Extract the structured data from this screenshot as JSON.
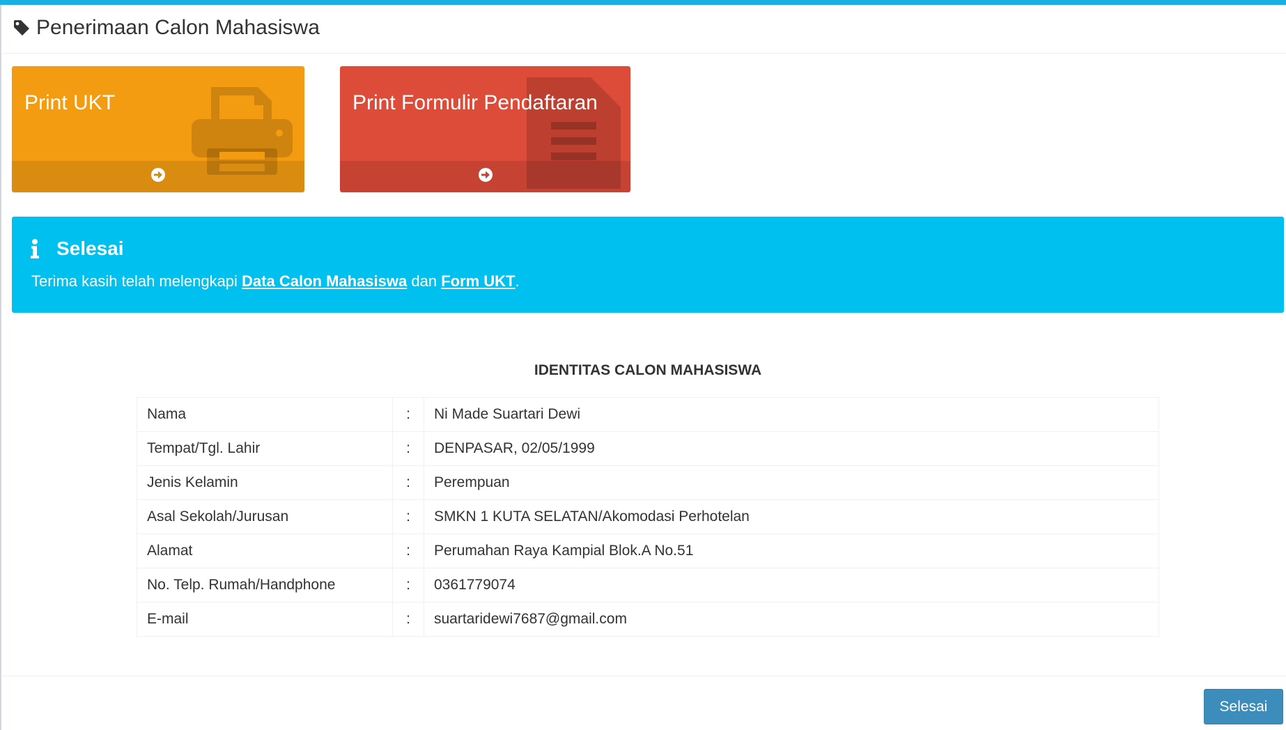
{
  "header": {
    "title": "Penerimaan Calon Mahasiswa",
    "icon": "tag-icon"
  },
  "boxes": [
    {
      "label": "Print UKT",
      "color": "#f39c12",
      "icon": "print-icon",
      "footer_icon": "arrow-circle-right-icon"
    },
    {
      "label": "Print Formulir Pendaftaran",
      "color": "#dd4b39",
      "icon": "file-text-icon",
      "footer_icon": "arrow-circle-right-icon"
    }
  ],
  "callout": {
    "color": "#00c0ef",
    "title": "Selesai",
    "text_before": "Terima kasih telah melengkapi ",
    "link1": "Data Calon Mahasiswa",
    "text_mid": " dan ",
    "link2": "Form UKT",
    "text_after": "."
  },
  "identity": {
    "title": "IDENTITAS CALON MAHASISWA",
    "separator": ":",
    "rows": [
      {
        "label": "Nama",
        "value": "Ni Made Suartari Dewi"
      },
      {
        "label": "Tempat/Tgl. Lahir",
        "value": "DENPASAR, 02/05/1999"
      },
      {
        "label": "Jenis Kelamin",
        "value": "Perempuan"
      },
      {
        "label": "Asal Sekolah/Jurusan",
        "value": "SMKN 1 KUTA SELATAN/Akomodasi Perhotelan"
      },
      {
        "label": "Alamat",
        "value": "Perumahan Raya Kampial Blok.A No.51"
      },
      {
        "label": "No. Telp. Rumah/Handphone",
        "value": "0361779074"
      },
      {
        "label": "E-mail",
        "value": "suartaridewi7687@gmail.com"
      }
    ]
  },
  "footer": {
    "button_label": "Selesai",
    "button_color": "#3c8dbc"
  }
}
